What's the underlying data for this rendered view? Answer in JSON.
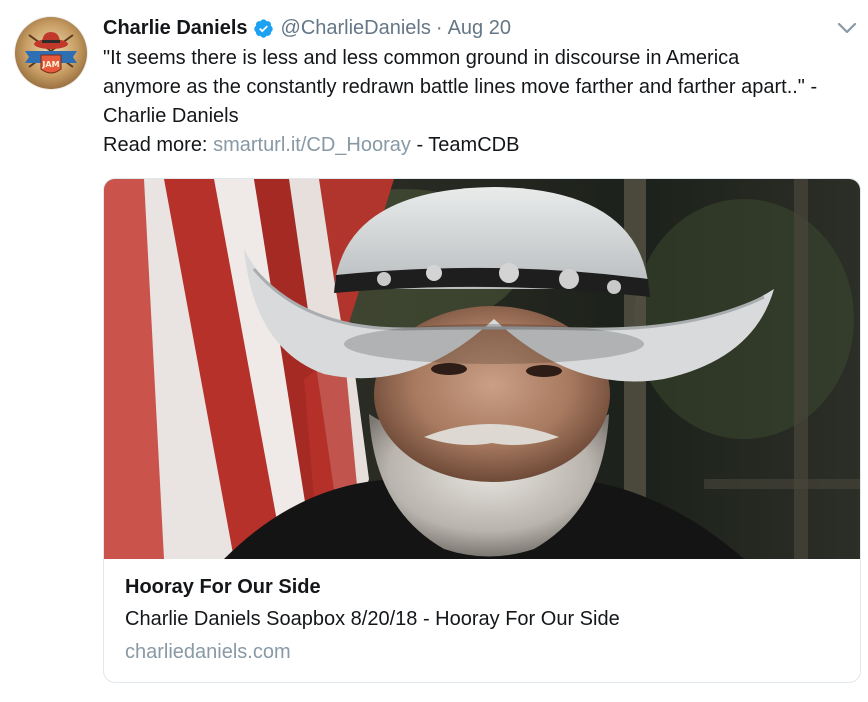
{
  "tweet": {
    "author_name": "Charlie Daniels",
    "handle": "@CharlieDaniels",
    "separator": "·",
    "date": "Aug 20",
    "verified_icon": "verified-badge-icon",
    "menu_icon": "chevron-down-icon",
    "text_lines": [
      "\"It seems there is less and less common ground in discourse in America",
      "anymore as the constantly redrawn battle lines move farther and farther apart..\" -",
      "Charlie Daniels"
    ],
    "read_more_label": "Read more:",
    "read_more_link": "smarturl.it/CD_Hooray",
    "read_more_suffix": "- TeamCDB"
  },
  "avatar": {
    "logo_text": "JAM"
  },
  "card": {
    "title": "Hooray For Our Side",
    "description": "Charlie Daniels Soapbox 8/20/18 - Hooray For Our Side",
    "domain": "charliedaniels.com"
  },
  "colors": {
    "text": "#14171a",
    "secondary": "#657786",
    "link": "#8899a6",
    "verified": "#1da1f2",
    "card_border": "#e1e8ed"
  }
}
